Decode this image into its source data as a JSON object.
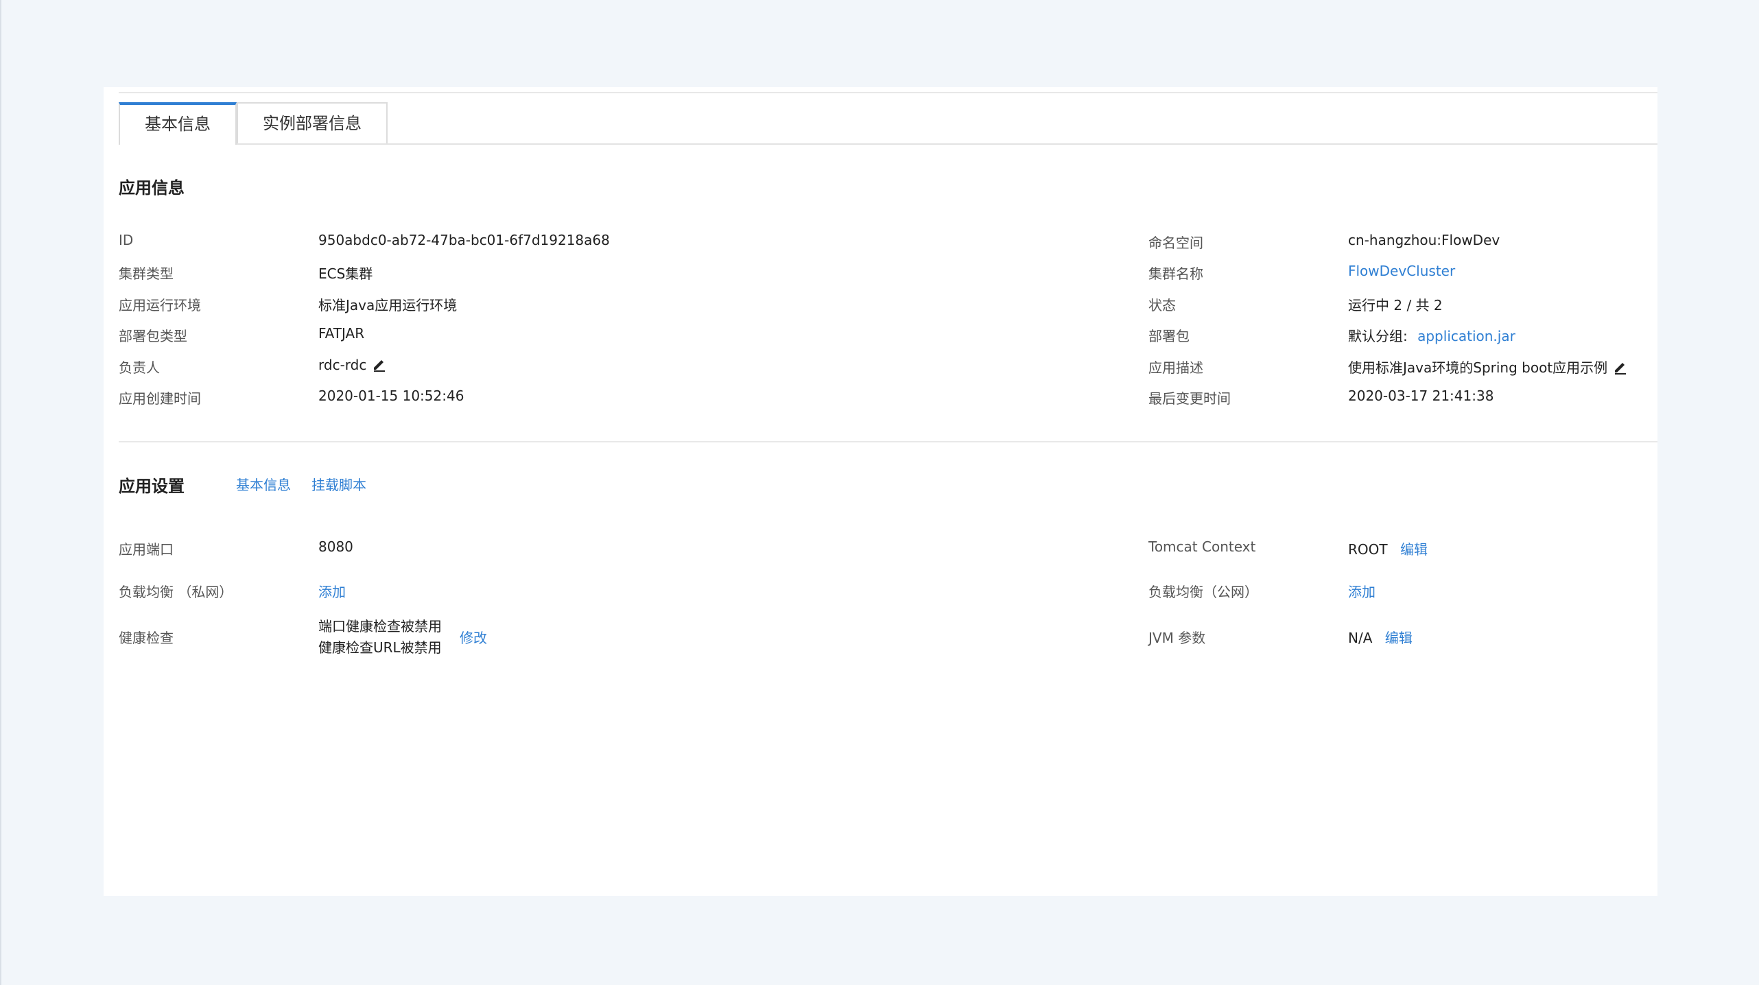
{
  "tabs": [
    {
      "label": "基本信息",
      "active": true
    },
    {
      "label": "实例部署信息",
      "active": false
    }
  ],
  "app_info": {
    "title": "应用信息",
    "left_rows": [
      {
        "label": "ID",
        "value": "950abdc0-ab72-47ba-bc01-6f7d19218a68"
      },
      {
        "label": "集群类型",
        "value": "ECS集群"
      },
      {
        "label": "应用运行环境",
        "value": "标准Java应用运行环境"
      },
      {
        "label": "部署包类型",
        "value": "FATJAR"
      },
      {
        "label": "负责人",
        "value": "rdc-rdc"
      },
      {
        "label": "应用创建时间",
        "value": "2020-01-15 10:52:46"
      }
    ],
    "right_rows": [
      {
        "label": "命名空间",
        "value": "cn-hangzhou:FlowDev"
      },
      {
        "label": "集群名称",
        "value": "FlowDevCluster"
      },
      {
        "label": "状态",
        "value": "运行中 2 / 共 2"
      },
      {
        "label": "部署包",
        "prefix": "默认分组:",
        "value": "application.jar"
      },
      {
        "label": "应用描述",
        "value": "使用标准Java环境的Spring boot应用示例"
      },
      {
        "label": "最后变更时间",
        "value": "2020-03-17 21:41:38"
      }
    ]
  },
  "app_settings": {
    "title": "应用设置",
    "links": [
      "基本信息",
      "挂载脚本"
    ],
    "port": {
      "label": "应用端口",
      "value": "8080"
    },
    "tomcat": {
      "label": "Tomcat Context",
      "value": "ROOT",
      "action": "编辑"
    },
    "slb_private": {
      "label": "负载均衡 （私网）",
      "action": "添加"
    },
    "slb_public": {
      "label": "负载均衡（公网）",
      "action": "添加"
    },
    "health": {
      "label": "健康检查",
      "line1": "端口健康检查被禁用",
      "line2": "健康检查URL被禁用",
      "action": "修改"
    },
    "jvm": {
      "label": "JVM 参数",
      "value": "N/A",
      "action": "编辑"
    }
  },
  "colors": {
    "link": "#2f7fd3",
    "tab_active_border": "#2f7fd3",
    "background": "#f2f6fa"
  }
}
